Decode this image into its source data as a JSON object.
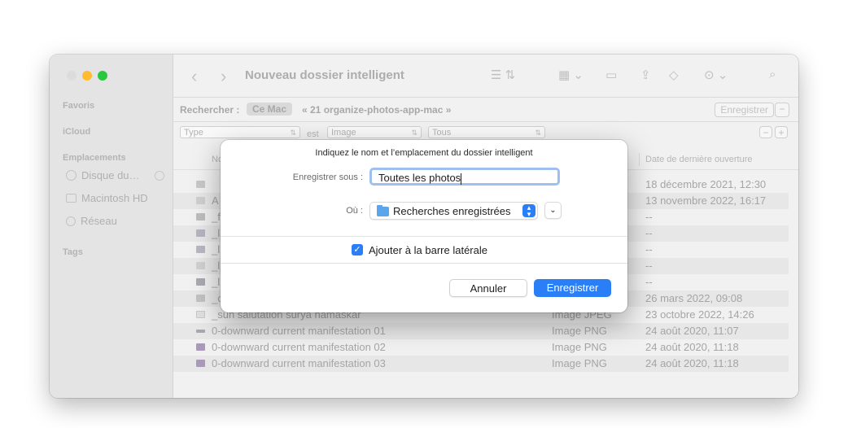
{
  "window": {
    "title": "Nouveau dossier intelligent",
    "traffic_lights": {
      "close": "#fe5f57",
      "minimize": "#febc2e",
      "zoom": "#28c840"
    }
  },
  "sidebar": {
    "sections": [
      {
        "header": "Favoris",
        "items": []
      },
      {
        "header": "iCloud",
        "items": []
      },
      {
        "header": "Emplacements",
        "items": [
          {
            "label": "Disque du…",
            "icon": "disk-icon"
          },
          {
            "label": "Macintosh HD",
            "icon": "hard-drive-icon"
          },
          {
            "label": "Réseau",
            "icon": "network-icon"
          }
        ]
      },
      {
        "header": "Tags",
        "items": []
      }
    ]
  },
  "toolbar": {
    "back_icon": "chevron-left-icon",
    "forward_icon": "chevron-right-icon",
    "icons": [
      "list-view-icon",
      "group-icon",
      "new-folder-icon",
      "share-icon",
      "tag-icon",
      "more-icon",
      "search-icon"
    ]
  },
  "search": {
    "label": "Rechercher :",
    "scope_mac": "Ce Mac",
    "scope_folder": "« 21 organize-photos-app-mac »",
    "save_button": "Enregistrer",
    "remove_button": "−"
  },
  "criteria": {
    "attribute": "Type",
    "operator": "est",
    "value": "Image",
    "subvalue": "Tous",
    "remove": "−",
    "add": "+"
  },
  "columns": {
    "name": "Nom",
    "date": "Date de dernière ouverture"
  },
  "rows": [
    {
      "name": "",
      "kind": "",
      "date": "18 décembre 2021, 12:30"
    },
    {
      "name": "A",
      "kind": "",
      "date": "13 novembre 2022, 16:17"
    },
    {
      "name": "_f",
      "kind": "",
      "date": "--"
    },
    {
      "name": "_l",
      "kind": "",
      "date": "--"
    },
    {
      "name": "_l",
      "kind": "",
      "date": "--"
    },
    {
      "name": "_l",
      "kind": "",
      "date": "--"
    },
    {
      "name": "_l",
      "kind": "",
      "date": "--"
    },
    {
      "name": "_c",
      "kind": "",
      "date": "26 mars 2022, 09:08"
    },
    {
      "name": "_sun salutation surya namaskar",
      "kind": "Image JPEG",
      "date": "23 octobre 2022, 14:26"
    },
    {
      "name": "0-downward current manifestation 01",
      "kind": "Image PNG",
      "date": "24 août 2020, 11:07"
    },
    {
      "name": "0-downward current manifestation 02",
      "kind": "Image PNG",
      "date": "24 août 2020, 11:18"
    },
    {
      "name": "0-downward current manifestation 03",
      "kind": "Image PNG",
      "date": "24 août 2020, 11:18"
    }
  ],
  "dialog": {
    "message": "Indiquez le nom et l’emplacement du dossier intelligent",
    "save_as_label": "Enregistrer sous :",
    "save_as_value": "Toutes les photos",
    "where_label": "Où :",
    "where_value": "Recherches enregistrées",
    "sidebar_checkbox_label": "Ajouter à la barre latérale",
    "sidebar_checkbox_checked": true,
    "cancel_label": "Annuler",
    "save_label": "Enregistrer",
    "accent_color": "#2b7ff6"
  }
}
